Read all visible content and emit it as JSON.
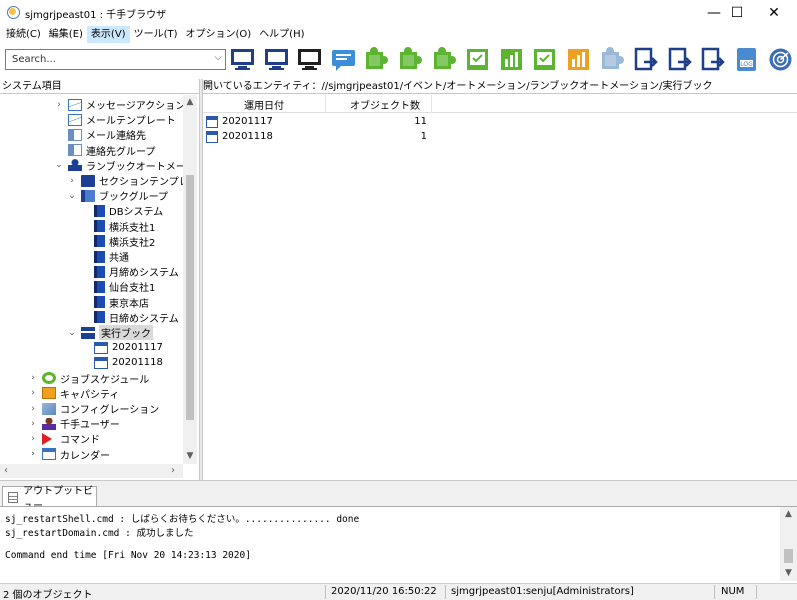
{
  "window": {
    "title": "sjmgrjpeast01 : 千手ブラウザ",
    "minimize": "—",
    "maximize": "☐",
    "close": "✕"
  },
  "menu": [
    {
      "label": "接続(C)",
      "active": false
    },
    {
      "label": "編集(E)",
      "active": false
    },
    {
      "label": "表示(V)",
      "active": true
    },
    {
      "label": "ツール(T)",
      "active": false
    },
    {
      "label": "オプション(O)",
      "active": false
    },
    {
      "label": "ヘルプ(H)",
      "active": false
    }
  ],
  "toolbar": {
    "search_placeholder": "Search...",
    "buttons": [
      {
        "icon": "network-monitor-icon",
        "color": "#1f3f8a"
      },
      {
        "icon": "monitor-icon",
        "color": "#1f3f8a"
      },
      {
        "icon": "screen-icon",
        "color": "#202020"
      },
      {
        "icon": "message-icon",
        "color": "#3b8fd8"
      },
      {
        "icon": "puzzle-green-icon",
        "color": "#5cb531"
      },
      {
        "icon": "puzzle-green-2-icon",
        "color": "#5cb531"
      },
      {
        "icon": "puzzle-green-3-icon",
        "color": "#5cb531"
      },
      {
        "icon": "check-monitor-icon",
        "color": "#5cb531"
      },
      {
        "icon": "bar-chart-icon",
        "color": "#5cb531"
      },
      {
        "icon": "document-list-icon",
        "color": "#5cb531"
      },
      {
        "icon": "building-chart-icon",
        "color": "#f0a020"
      },
      {
        "icon": "puzzle-grey-icon",
        "color": "#9ab8d8"
      },
      {
        "icon": "export-document-icon",
        "color": "#1f3f8a"
      },
      {
        "icon": "export-document-2-icon",
        "color": "#1f3f8a"
      },
      {
        "icon": "export-document-3-icon",
        "color": "#1f3f8a"
      },
      {
        "icon": "log-document-icon",
        "color": "#4a8ad0"
      },
      {
        "icon": "radar-icon",
        "color": "#3c6eb4"
      }
    ]
  },
  "left_pane": {
    "header": "システム項目",
    "tree": [
      {
        "label": "メッセージアクション",
        "indent": 4,
        "chevron": ">",
        "icon": "envelope-icon"
      },
      {
        "label": "メールテンプレート",
        "indent": 4,
        "chevron": "",
        "icon": "envelope-icon"
      },
      {
        "label": "メール連絡先",
        "indent": 4,
        "chevron": "",
        "icon": "contact-card-icon"
      },
      {
        "label": "連絡先グループ",
        "indent": 4,
        "chevron": "",
        "icon": "contact-card-icon"
      },
      {
        "label": "ランブックオートメーション",
        "indent": 4,
        "chevron": "v",
        "icon": "person-computer-icon"
      },
      {
        "label": "セクションテンプレー",
        "indent": 5,
        "chevron": ">",
        "icon": "section-template-icon"
      },
      {
        "label": "ブックグループ",
        "indent": 5,
        "chevron": "v",
        "icon": "book-group-icon"
      },
      {
        "label": "DBシステム",
        "indent": 6,
        "chevron": "",
        "icon": "book-icon"
      },
      {
        "label": "横浜支社1",
        "indent": 6,
        "chevron": "",
        "icon": "book-icon"
      },
      {
        "label": "横浜支社2",
        "indent": 6,
        "chevron": "",
        "icon": "book-icon"
      },
      {
        "label": "共通",
        "indent": 6,
        "chevron": "",
        "icon": "book-icon"
      },
      {
        "label": "月締めシステム",
        "indent": 6,
        "chevron": "",
        "icon": "book-icon"
      },
      {
        "label": "仙台支社1",
        "indent": 6,
        "chevron": "",
        "icon": "book-icon"
      },
      {
        "label": "東京本店",
        "indent": 6,
        "chevron": "",
        "icon": "book-icon"
      },
      {
        "label": "日締めシステム",
        "indent": 6,
        "chevron": "",
        "icon": "book-icon"
      },
      {
        "label": "実行ブック",
        "indent": 5,
        "chevron": "v",
        "icon": "run-book-icon",
        "selected": true
      },
      {
        "label": "20201117",
        "indent": 6,
        "chevron": "",
        "icon": "calendar-check-icon"
      },
      {
        "label": "20201118",
        "indent": 6,
        "chevron": "",
        "icon": "calendar-check-icon"
      },
      {
        "label": "ジョブスケジュール",
        "indent": 2,
        "chevron": ">",
        "icon": "job-schedule-icon"
      },
      {
        "label": "キャパシティ",
        "indent": 2,
        "chevron": ">",
        "icon": "capacity-icon"
      },
      {
        "label": "コンフィグレーション",
        "indent": 2,
        "chevron": ">",
        "icon": "configuration-icon"
      },
      {
        "label": "千手ユーザー",
        "indent": 2,
        "chevron": ">",
        "icon": "user-icon"
      },
      {
        "label": "コマンド",
        "indent": 2,
        "chevron": ">",
        "icon": "command-icon"
      },
      {
        "label": "カレンダー",
        "indent": 2,
        "chevron": ">",
        "icon": "calendar-icon"
      }
    ]
  },
  "right_pane": {
    "breadcrumb": "開いているエンティティ：//sjmgrjpeast01/イベント/オートメーション/ランブックオートメーション/実行ブック",
    "columns": [
      "運用日付",
      "オブジェクト数"
    ],
    "rows": [
      {
        "date": "20201117",
        "count": "11"
      },
      {
        "date": "20201118",
        "count": "1"
      }
    ]
  },
  "output": {
    "tab_label": "アウトプットビュー",
    "lines": [
      "sj_restartShell.cmd : しばらくお待ちください。............... done",
      "sj_restartDomain.cmd : 成功しました",
      "",
      "Command end time [Fri Nov 20 14:23:13 2020]"
    ]
  },
  "status": {
    "objects": "2 個のオブジェクト",
    "datetime": "2020/11/20 16:50:22",
    "connection": "sjmgrjpeast01:senju[Administrators]",
    "num": "NUM"
  }
}
